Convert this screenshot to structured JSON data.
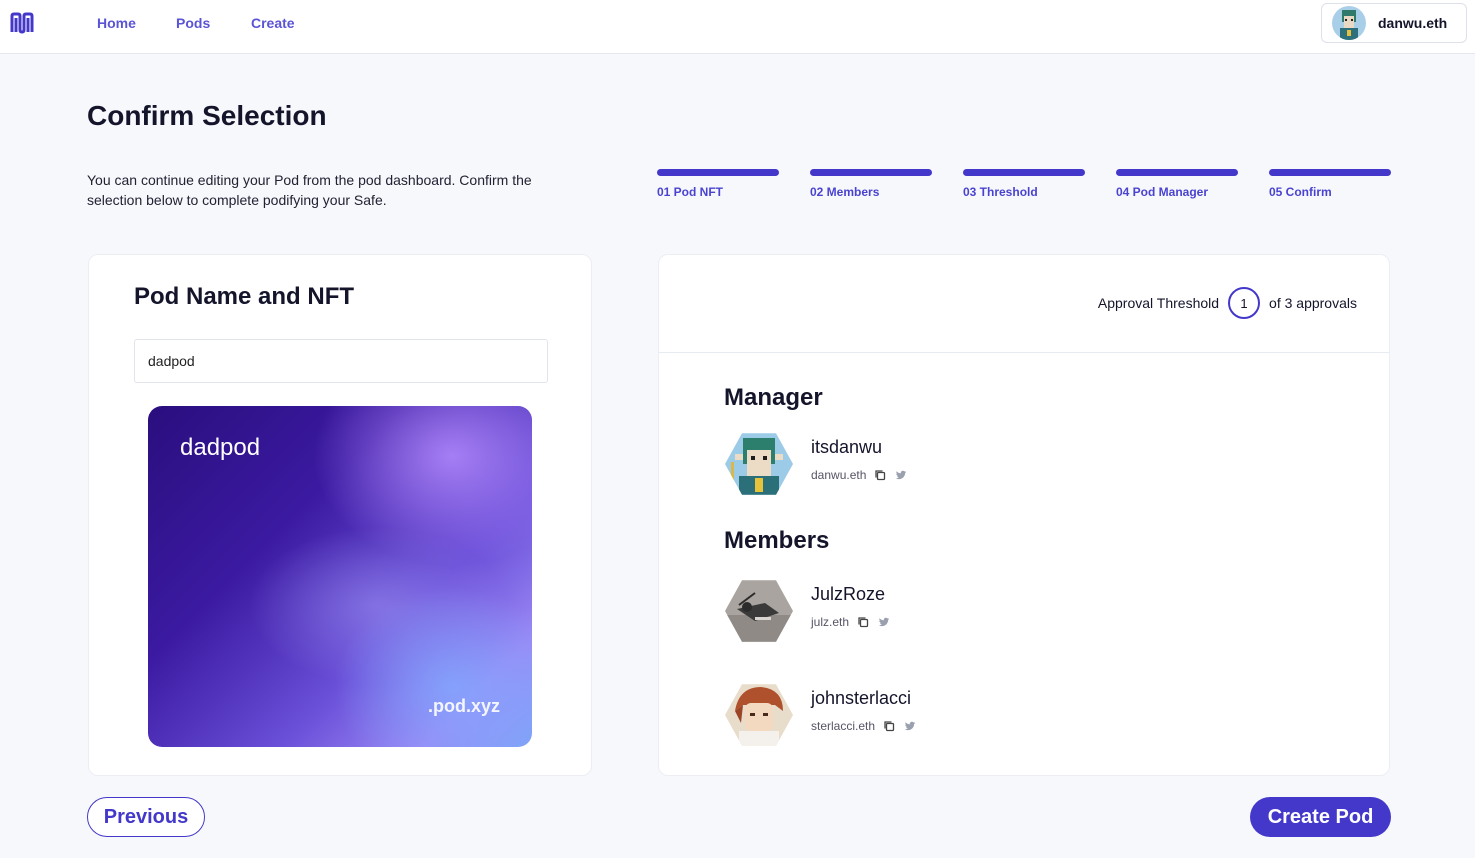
{
  "nav": {
    "logo_icon": "pod-logo-icon",
    "links": [
      "Home",
      "Pods",
      "Create"
    ],
    "user_name": "danwu.eth"
  },
  "header": {
    "title": "Confirm Selection",
    "subtitle": "You can continue editing your Pod from the pod dashboard. Confirm the selection below to complete podifying your Safe."
  },
  "steps": [
    {
      "label": "01 Pod NFT"
    },
    {
      "label": "02 Members"
    },
    {
      "label": "03 Threshold"
    },
    {
      "label": "04 Pod Manager"
    },
    {
      "label": "05 Confirm"
    }
  ],
  "pod_card": {
    "title": "Pod Name and NFT",
    "name_value": "dadpod",
    "nft_name": "dadpod",
    "nft_domain": ".pod.xyz"
  },
  "threshold": {
    "label": "Approval Threshold",
    "value": "1",
    "suffix": "of 3 approvals"
  },
  "manager": {
    "section_title": "Manager",
    "name": "itsdanwu",
    "ens": "danwu.eth"
  },
  "members": {
    "section_title": "Members",
    "list": [
      {
        "name": "JulzRoze",
        "ens": "julz.eth"
      },
      {
        "name": "johnsterlacci",
        "ens": "sterlacci.eth"
      }
    ]
  },
  "buttons": {
    "previous": "Previous",
    "create": "Create Pod"
  },
  "colors": {
    "accent": "#4338ca",
    "nav_link": "#5b54d6",
    "background": "#f7f8fc"
  }
}
